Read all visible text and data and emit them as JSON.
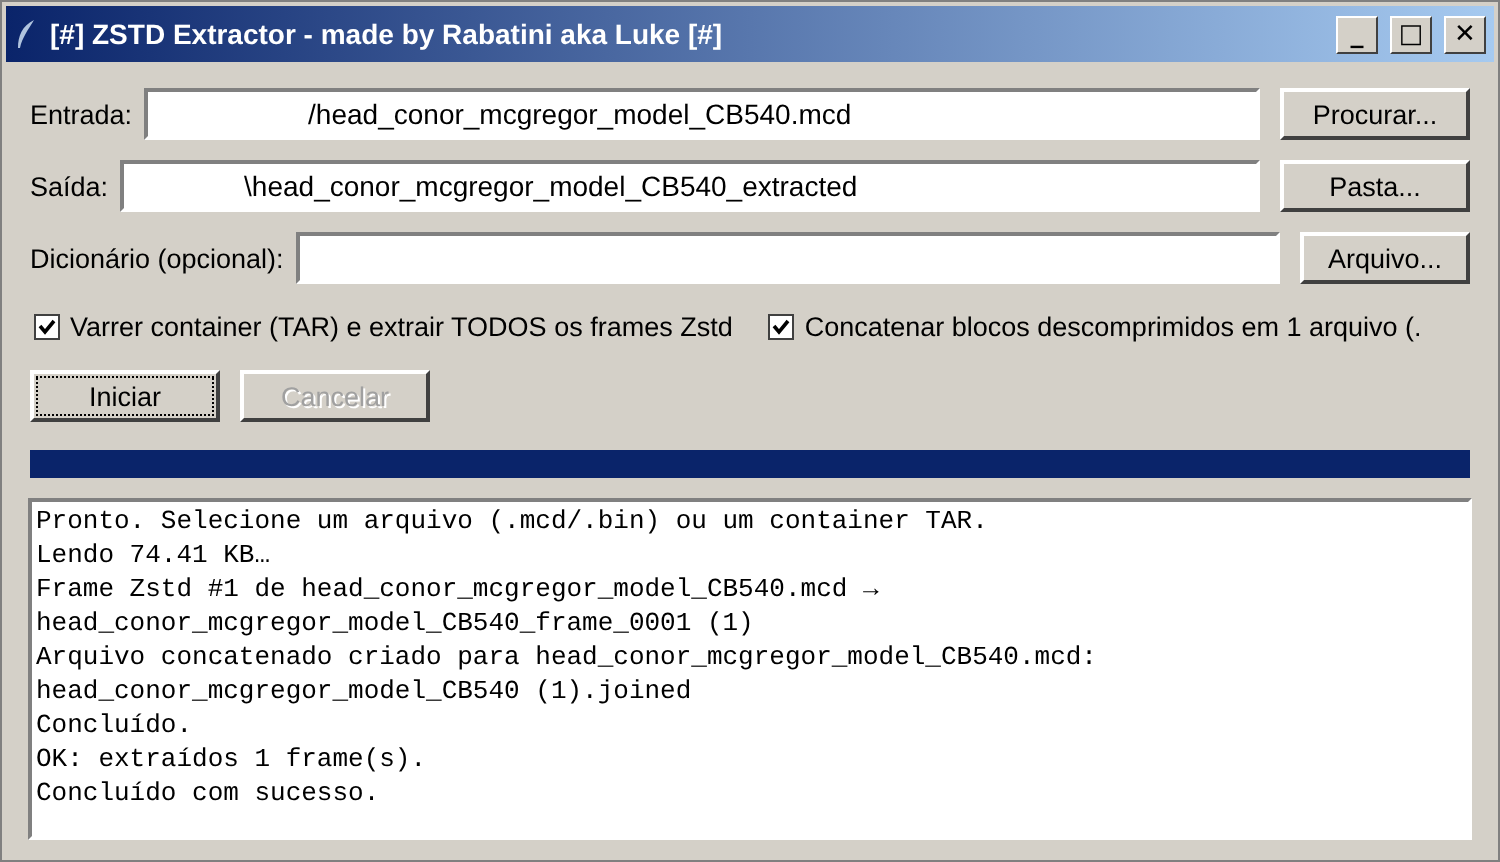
{
  "window": {
    "title": "[#] ZSTD Extractor - made by Rabatini aka Luke [#]",
    "controls": [
      "_",
      "□",
      "✕"
    ]
  },
  "fields": [
    {
      "label": "Entrada:",
      "value": "/head_conor_mcgregor_model_CB540.mcd",
      "button": "Procurar..."
    },
    {
      "label": "Saída:",
      "value": "\\head_conor_mcgregor_model_CB540_extracted",
      "button": "Pasta..."
    },
    {
      "label": "Dicionário (opcional):",
      "button": "Arquivo..."
    }
  ],
  "options": [
    {
      "label": "Varrer container (TAR) e extrair TODOS os frames Zstd",
      "checked": true
    },
    {
      "label": "Concatenar blocos descomprimidos em 1 arquivo (.",
      "checked": true
    }
  ],
  "actions": [
    {
      "label": "Iniciar",
      "disabled": false
    },
    {
      "label": "Cancelar",
      "disabled": true
    }
  ],
  "progress": {
    "level": 1
  },
  "log": [
    "Pronto. Selecione um arquivo (.mcd/.bin) ou um container TAR.",
    "Lendo 74.41 KB…",
    "Frame Zstd #1 de head_conor_mcgregor_model_CB540.mcd →",
    "head_conor_mcgregor_model_CB540_frame_0001 (1)",
    "Arquivo concatenado criado para head_conor_mcgregor_model_CB540.mcd:",
    "head_conor_mcgregor_model_CB540 (1).joined",
    "Concluído.",
    "OK: extraídos 1 frame(s).",
    "Concluído com sucesso."
  ]
}
